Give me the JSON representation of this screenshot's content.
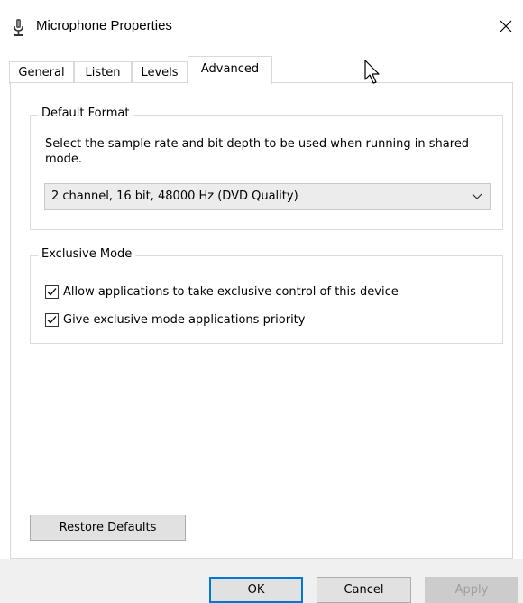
{
  "window": {
    "title": "Microphone Properties",
    "icon": "microphone-icon",
    "close_glyph": "✕"
  },
  "tabs": [
    {
      "label": "General",
      "active": false
    },
    {
      "label": "Listen",
      "active": false
    },
    {
      "label": "Levels",
      "active": false
    },
    {
      "label": "Advanced",
      "active": true
    }
  ],
  "default_format": {
    "legend": "Default Format",
    "description": "Select the sample rate and bit depth to be used when running in shared mode.",
    "selected": "2 channel, 16 bit, 48000 Hz (DVD Quality)"
  },
  "exclusive_mode": {
    "legend": "Exclusive Mode",
    "options": [
      {
        "label": "Allow applications to take exclusive control of this device",
        "checked": true
      },
      {
        "label": "Give exclusive mode applications priority",
        "checked": true
      }
    ]
  },
  "buttons": {
    "restore_defaults": "Restore Defaults",
    "ok": "OK",
    "cancel": "Cancel",
    "apply": "Apply"
  },
  "colors": {
    "accent": "#0078d7",
    "footer": "#f0f0f0",
    "disabled_text": "#a0a0a0"
  }
}
